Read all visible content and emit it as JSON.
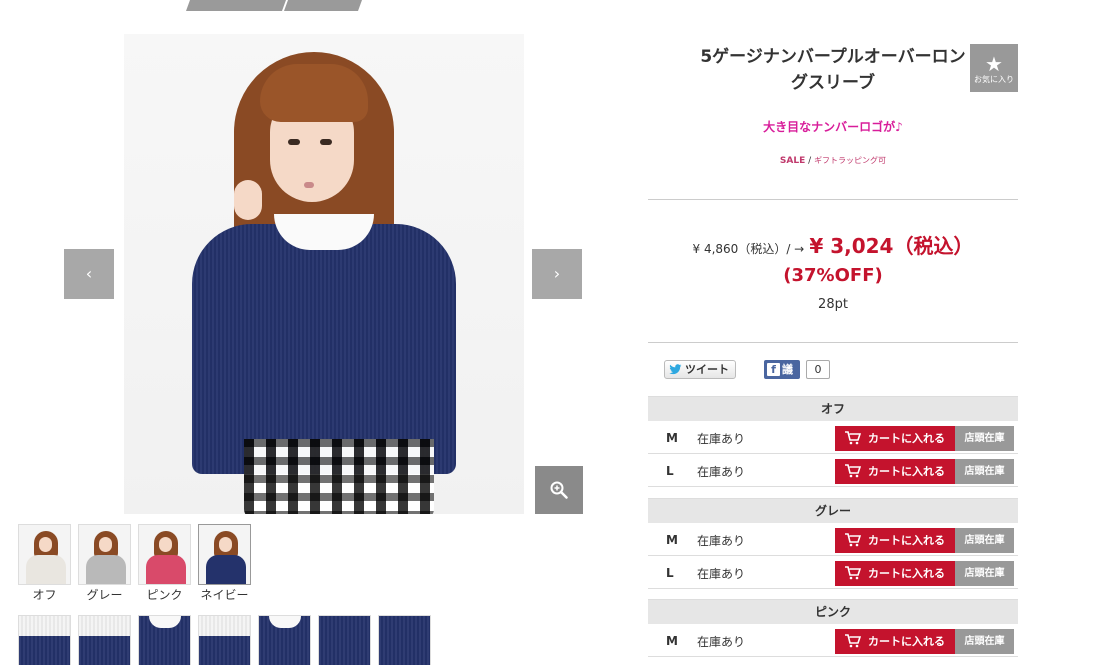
{
  "breadcrumb": {
    "items": [
      "",
      ""
    ],
    "trail": ""
  },
  "gallery": {
    "prev_icon": "chevron-left-icon",
    "prev_label": "‹",
    "next_icon": "chevron-right-icon",
    "next_label": "›",
    "zoom_icon": "zoom-in-icon",
    "colors": [
      {
        "label": "オフ",
        "swatch": "#e9e6e0",
        "selected": false
      },
      {
        "label": "グレー",
        "swatch": "#b9b9b9",
        "selected": false
      },
      {
        "label": "ピンク",
        "swatch": "#d94a6a",
        "selected": false
      },
      {
        "label": "ネイビー",
        "swatch": "#24326b",
        "selected": true
      }
    ],
    "detail_thumb_count": 7
  },
  "product": {
    "title": "5ゲージナンバープルオーバーロングスリーブ",
    "favorite_icon": "star-icon",
    "favorite_star": "★",
    "favorite_label": "お気に入り",
    "catch_copy": "大き目なナンバーロゴが♪",
    "tag_sale": "SALE",
    "tag_separator": "/",
    "tag_gift": "ギフトラッピング可",
    "price_original": "¥ 4,860（税込）/ →",
    "price_sale": "¥ 3,024（税込）",
    "discount": "(37%OFF)",
    "points": "28pt",
    "accent_color": "#c4132d",
    "catch_color": "#d81d9a"
  },
  "social": {
    "tweet_icon": "twitter-bird-icon",
    "tweet_label": "ツイート",
    "fb_icon": "facebook-icon",
    "fb_f": "f",
    "fb_label": "議",
    "fb_count": "0"
  },
  "stock": {
    "cart_icon": "cart-icon",
    "groups": [
      {
        "color": "オフ",
        "rows": [
          {
            "size": "M",
            "status": "在庫あり",
            "cart_label": "カートに入れる",
            "store_label": "店頭在庫"
          },
          {
            "size": "L",
            "status": "在庫あり",
            "cart_label": "カートに入れる",
            "store_label": "店頭在庫"
          }
        ]
      },
      {
        "color": "グレー",
        "rows": [
          {
            "size": "M",
            "status": "在庫あり",
            "cart_label": "カートに入れる",
            "store_label": "店頭在庫"
          },
          {
            "size": "L",
            "status": "在庫あり",
            "cart_label": "カートに入れる",
            "store_label": "店頭在庫"
          }
        ]
      },
      {
        "color": "ピンク",
        "rows": [
          {
            "size": "M",
            "status": "在庫あり",
            "cart_label": "カートに入れる",
            "store_label": "店頭在庫"
          }
        ]
      }
    ]
  }
}
